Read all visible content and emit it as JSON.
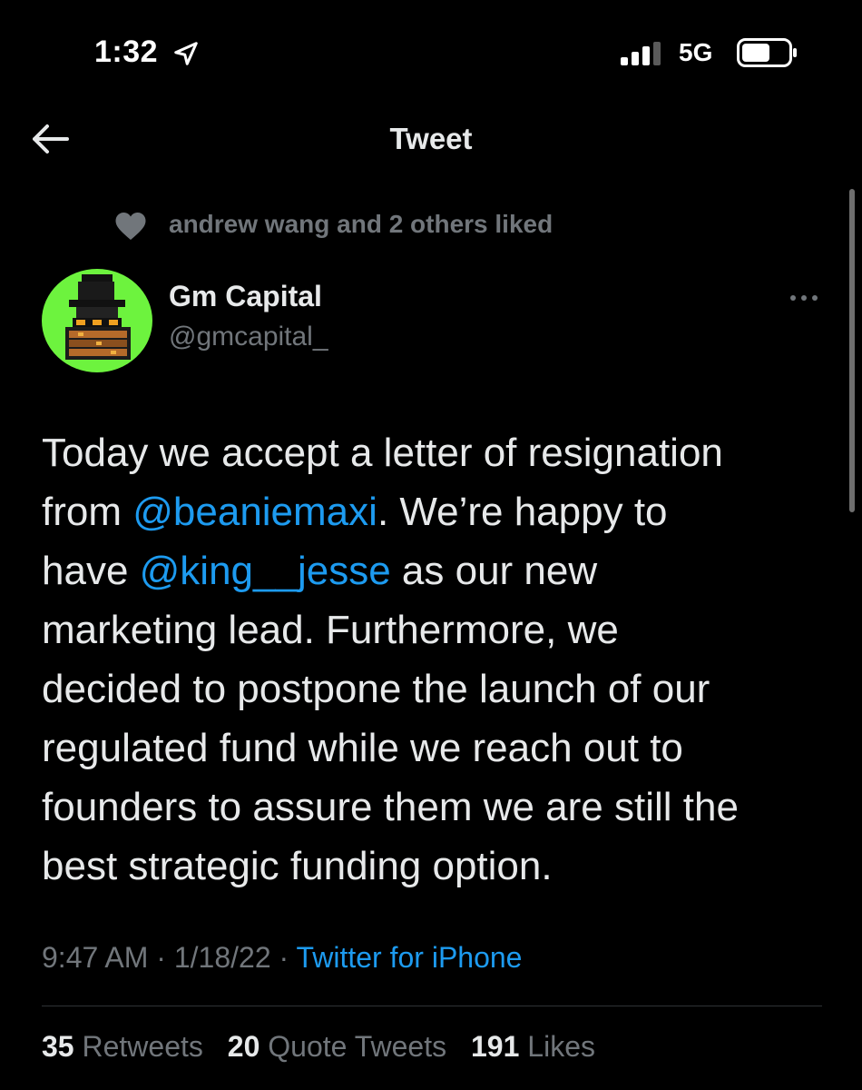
{
  "status_bar": {
    "time": "1:32",
    "network": "5G"
  },
  "header": {
    "title": "Tweet"
  },
  "social_context": {
    "text": "andrew wang and 2 others liked"
  },
  "author": {
    "name": "Gm Capital",
    "handle": "@gmcapital_"
  },
  "tweet": {
    "lines": [
      [
        {
          "t": "Today we accept a letter of resignation"
        }
      ],
      [
        {
          "t": "from "
        },
        {
          "t": "@beaniemaxi",
          "mention": true
        },
        {
          "t": ". We’re happy to"
        }
      ],
      [
        {
          "t": "have "
        },
        {
          "t": "@king__jesse",
          "mention": true
        },
        {
          "t": " as our new"
        }
      ],
      [
        {
          "t": "marketing lead. Furthermore, we"
        }
      ],
      [
        {
          "t": "decided to postpone the launch of our"
        }
      ],
      [
        {
          "t": "regulated fund while we reach out to"
        }
      ],
      [
        {
          "t": "founders to assure them we are still the"
        }
      ],
      [
        {
          "t": "best strategic funding option."
        }
      ]
    ]
  },
  "meta": {
    "time": "9:47 AM",
    "date": "1/18/22",
    "separator": " · ",
    "source": "Twitter for iPhone"
  },
  "stats": {
    "retweets": {
      "count": "35",
      "label": "Retweets"
    },
    "quotes": {
      "count": "20",
      "label": "Quote Tweets"
    },
    "likes": {
      "count": "191",
      "label": "Likes"
    }
  },
  "icons": {
    "back": "arrow-left-icon",
    "location": "location-arrow-icon",
    "signal": "cellular-signal-icon",
    "battery": "battery-icon",
    "heart": "heart-icon",
    "more": "more-dots-icon"
  },
  "colors": {
    "background": "#000000",
    "text": "#e7e9ea",
    "secondary": "#71767b",
    "accent": "#1d9bf0",
    "avatar_bg": "#6df33e"
  }
}
